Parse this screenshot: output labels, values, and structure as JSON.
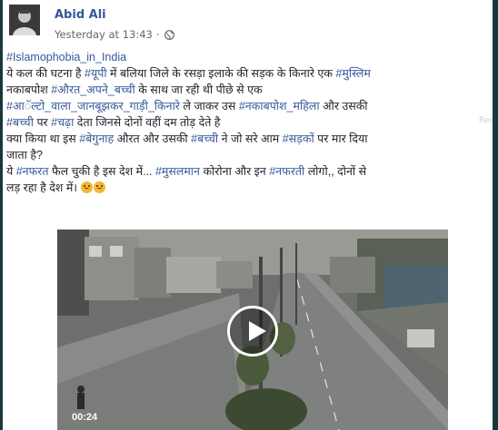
{
  "author": {
    "name": "Abid Ali"
  },
  "meta": {
    "time": "Yesterday at 13:43",
    "separator": "·",
    "privacy_icon": "globe-icon"
  },
  "post": {
    "hashtag_line": "#Islamophobia_in_India",
    "line2": [
      "ये कल की घटना है ",
      "#यूपी",
      " में बलिया जिले के रसड़ा इलाके की सड़क के किनारे एक ",
      "#मुस्लिम"
    ],
    "line3": [
      "नकाबपोश ",
      "#औरत_अपने_बच्ची",
      " के साथ जा रही थी पीछे से एक"
    ],
    "line4": [
      "#आॅल्टो_वाला_जानबूझकर_गाड़ी_किनारे",
      " ले जाकर उस ",
      "#नकाबपोश_महिला",
      " और उसकी"
    ],
    "line5": [
      "#बच्ची",
      " पर ",
      "#चढ़ा",
      " देता जिनसे दोनों वहीं दम तोड़ देते है"
    ],
    "line6": [
      "क्या किया था इस ",
      "#बेगुनाह",
      " औरत और उसकी ",
      "#बच्ची",
      " ने जो सरे आम ",
      "#सड़कों",
      " पर मार दिया"
    ],
    "line7": "जाता है?",
    "line8": [
      "ये ",
      "#नफरत",
      " फैल चुकी है इस देश में... ",
      "#मुसलमान",
      " कोरोना और इन ",
      "#नफरती",
      " लोगो,, दोनों से"
    ],
    "line9": "लड़ रहा है देश में।"
  },
  "emoji": {
    "count": 2,
    "icon": "sad-face-emoji"
  },
  "video": {
    "timestamp": "00:24",
    "play_icon": "play-icon"
  },
  "sidebar_fragment": {
    "text": "Rec"
  },
  "colors": {
    "link": "#365899",
    "text": "#1d2129",
    "meta": "#616770",
    "background": "#16383c"
  }
}
